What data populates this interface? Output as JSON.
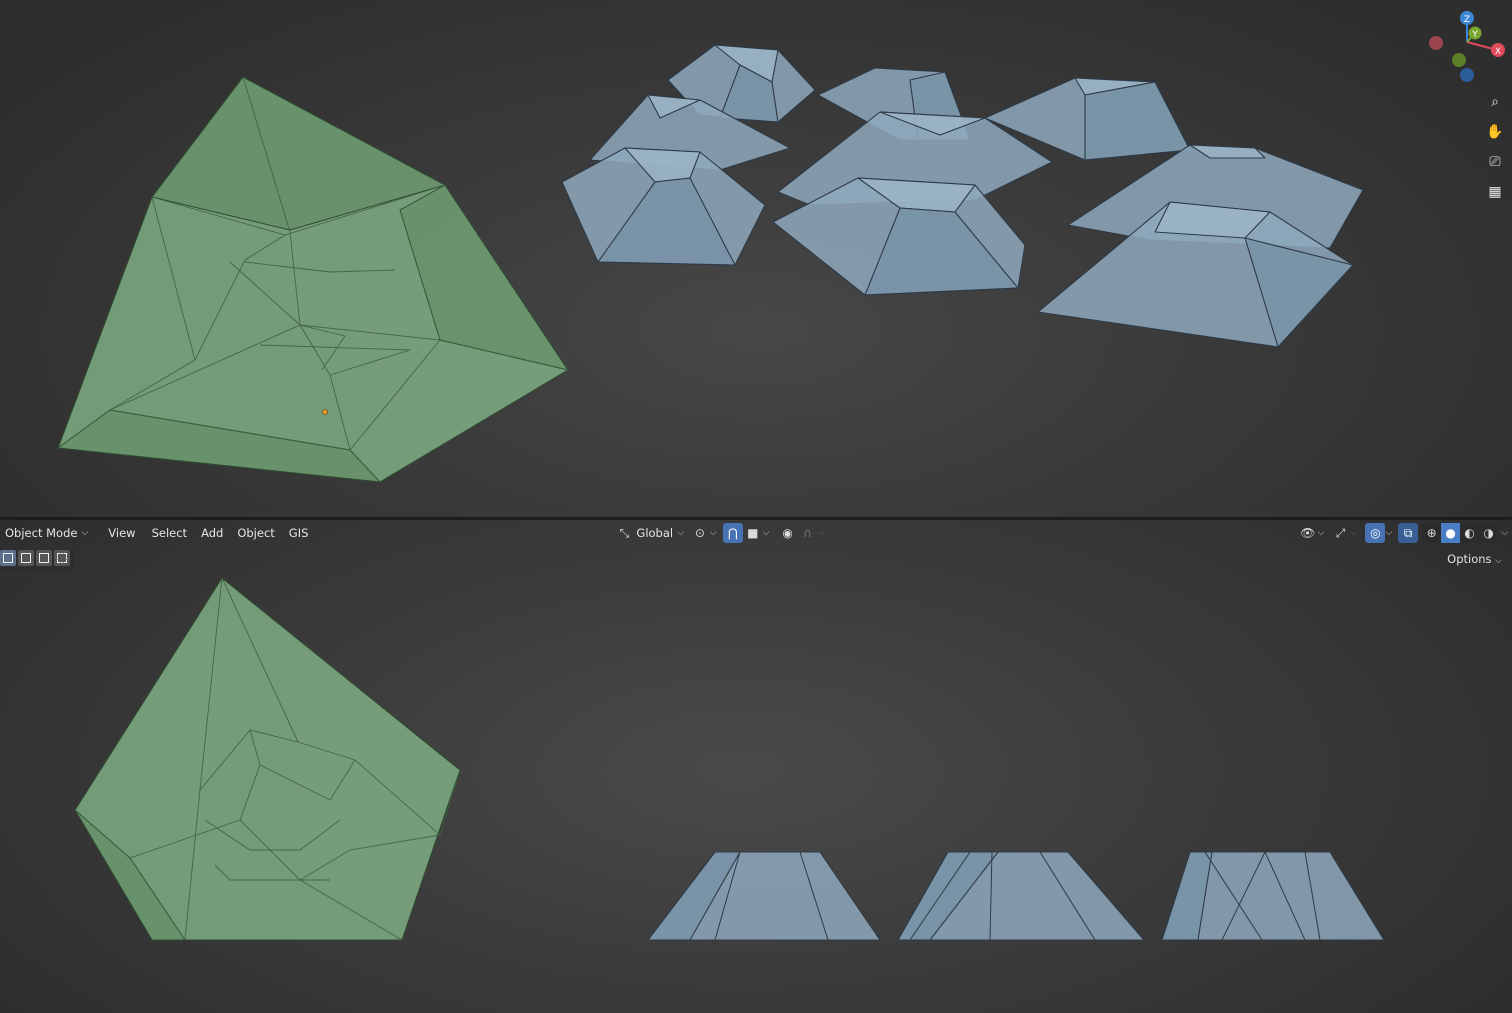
{
  "header": {
    "mode": "Object Mode",
    "menus": [
      "View",
      "Select",
      "Add",
      "Object",
      "GIS"
    ],
    "orientation": "Global",
    "options_label": "Options"
  },
  "gizmo": {
    "axes": {
      "x": "X",
      "y": "Y",
      "z": "Z"
    },
    "colors": {
      "x": "#e04a5a",
      "y": "#7aa531",
      "z": "#3d86d6"
    }
  },
  "nav_icons": [
    "zoom-icon",
    "pan-hand-icon",
    "camera-icon",
    "perspective-grid-icon"
  ],
  "colors": {
    "selected_mesh": "#82b287",
    "other_mesh": "#8fa9bd",
    "active_toggle": "#4772b3",
    "background": "#3b3b3b"
  }
}
